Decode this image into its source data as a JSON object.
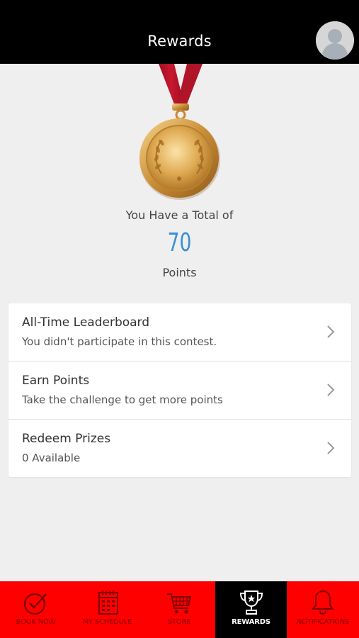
{
  "header": {
    "title": "Rewards"
  },
  "summary": {
    "intro": "You Have a Total of",
    "points": "70",
    "unit": "Points"
  },
  "list": [
    {
      "title": "All-Time Leaderboard",
      "subtitle": "You didn't participate in this contest."
    },
    {
      "title": "Earn Points",
      "subtitle": "Take the challenge to get more points"
    },
    {
      "title": "Redeem Prizes",
      "subtitle": "0 Available"
    }
  ],
  "nav": [
    {
      "label": "BOOK NOW",
      "icon": "check-circle-icon",
      "active": false
    },
    {
      "label": "MY SCHEDULE",
      "icon": "calendar-icon",
      "active": false
    },
    {
      "label": "STORE",
      "icon": "cart-icon",
      "active": false
    },
    {
      "label": "REWARDS",
      "icon": "trophy-icon",
      "active": true
    },
    {
      "label": "NOTIFICATIONS",
      "icon": "bell-icon",
      "active": false
    }
  ],
  "colors": {
    "header_bg": "#000000",
    "accent_points": "#3a8fd8",
    "nav_bg": "#ff0000",
    "nav_active_bg": "#000000",
    "medal_ribbon": "#c0142b",
    "medal_gold": "#d9a24a"
  }
}
